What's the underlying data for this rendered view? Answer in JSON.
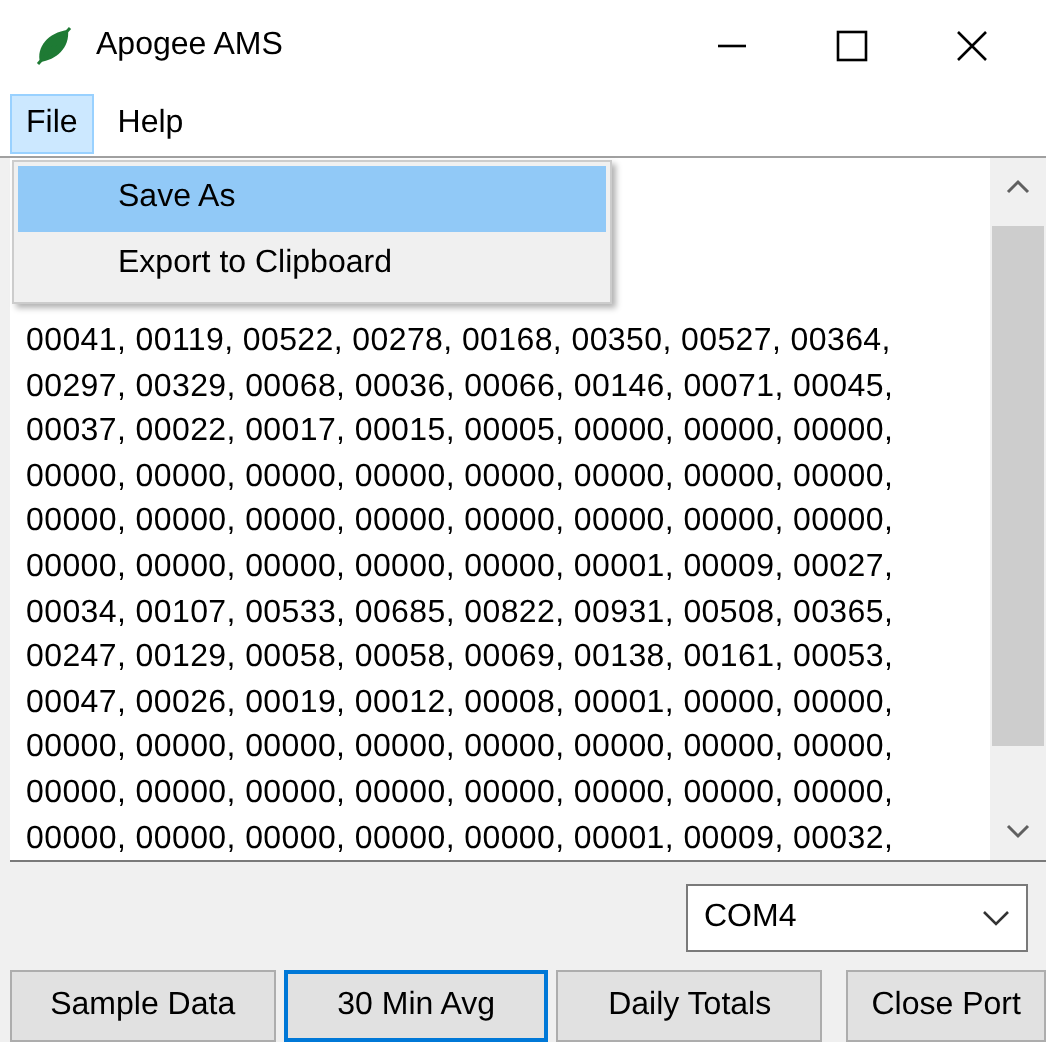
{
  "window": {
    "title": "Apogee AMS"
  },
  "menu_bar": [
    {
      "label": "File",
      "selected": true
    },
    {
      "label": "Help",
      "selected": false
    }
  ],
  "file_menu": [
    {
      "label": "Save As",
      "selected": true
    },
    {
      "label": "Export to Clipboard",
      "selected": false
    }
  ],
  "data_lines": [
    "00041, 00119, 00522, 00278, 00168, 00350, 00527, 00364,",
    "00297, 00329, 00068, 00036, 00066, 00146, 00071, 00045,",
    "00037, 00022, 00017, 00015, 00005, 00000, 00000, 00000,",
    "00000, 00000, 00000, 00000, 00000, 00000, 00000, 00000,",
    "00000, 00000, 00000, 00000, 00000, 00000, 00000, 00000,",
    "00000, 00000, 00000, 00000, 00000, 00001, 00009, 00027,",
    "00034, 00107, 00533, 00685, 00822, 00931, 00508, 00365,",
    "00247, 00129, 00058, 00058, 00069, 00138, 00161, 00053,",
    "00047, 00026, 00019, 00012, 00008, 00001, 00000, 00000,",
    "00000, 00000, 00000, 00000, 00000, 00000, 00000, 00000,",
    "00000, 00000, 00000, 00000, 00000, 00000, 00000, 00000,",
    "00000, 00000, 00000, 00000, 00000, 00001, 00009, 00032,"
  ],
  "port_select": {
    "value": "COM4"
  },
  "buttons": [
    {
      "label": "Sample Data",
      "focused": false
    },
    {
      "label": "30 Min Avg",
      "focused": true
    },
    {
      "label": "Daily Totals",
      "focused": false
    },
    {
      "label": "Close Port",
      "focused": false
    }
  ]
}
